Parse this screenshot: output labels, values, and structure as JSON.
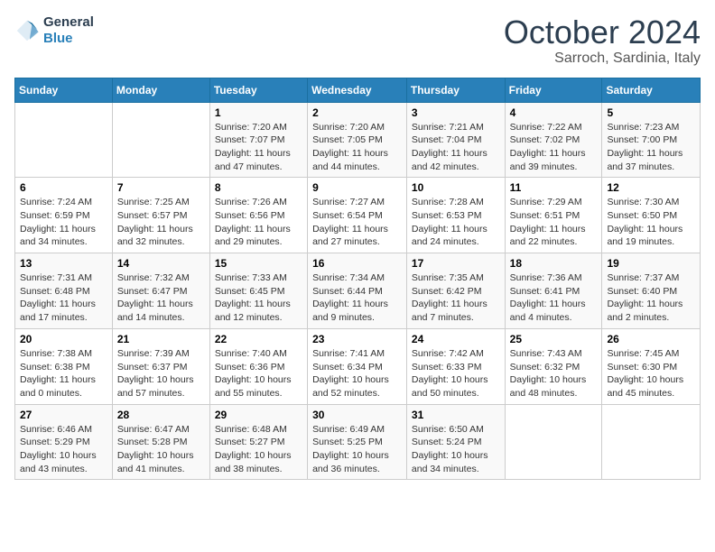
{
  "logo": {
    "line1": "General",
    "line2": "Blue"
  },
  "title": "October 2024",
  "location": "Sarroch, Sardinia, Italy",
  "headers": [
    "Sunday",
    "Monday",
    "Tuesday",
    "Wednesday",
    "Thursday",
    "Friday",
    "Saturday"
  ],
  "weeks": [
    [
      {
        "day": "",
        "info": ""
      },
      {
        "day": "",
        "info": ""
      },
      {
        "day": "1",
        "info": "Sunrise: 7:20 AM\nSunset: 7:07 PM\nDaylight: 11 hours and 47 minutes."
      },
      {
        "day": "2",
        "info": "Sunrise: 7:20 AM\nSunset: 7:05 PM\nDaylight: 11 hours and 44 minutes."
      },
      {
        "day": "3",
        "info": "Sunrise: 7:21 AM\nSunset: 7:04 PM\nDaylight: 11 hours and 42 minutes."
      },
      {
        "day": "4",
        "info": "Sunrise: 7:22 AM\nSunset: 7:02 PM\nDaylight: 11 hours and 39 minutes."
      },
      {
        "day": "5",
        "info": "Sunrise: 7:23 AM\nSunset: 7:00 PM\nDaylight: 11 hours and 37 minutes."
      }
    ],
    [
      {
        "day": "6",
        "info": "Sunrise: 7:24 AM\nSunset: 6:59 PM\nDaylight: 11 hours and 34 minutes."
      },
      {
        "day": "7",
        "info": "Sunrise: 7:25 AM\nSunset: 6:57 PM\nDaylight: 11 hours and 32 minutes."
      },
      {
        "day": "8",
        "info": "Sunrise: 7:26 AM\nSunset: 6:56 PM\nDaylight: 11 hours and 29 minutes."
      },
      {
        "day": "9",
        "info": "Sunrise: 7:27 AM\nSunset: 6:54 PM\nDaylight: 11 hours and 27 minutes."
      },
      {
        "day": "10",
        "info": "Sunrise: 7:28 AM\nSunset: 6:53 PM\nDaylight: 11 hours and 24 minutes."
      },
      {
        "day": "11",
        "info": "Sunrise: 7:29 AM\nSunset: 6:51 PM\nDaylight: 11 hours and 22 minutes."
      },
      {
        "day": "12",
        "info": "Sunrise: 7:30 AM\nSunset: 6:50 PM\nDaylight: 11 hours and 19 minutes."
      }
    ],
    [
      {
        "day": "13",
        "info": "Sunrise: 7:31 AM\nSunset: 6:48 PM\nDaylight: 11 hours and 17 minutes."
      },
      {
        "day": "14",
        "info": "Sunrise: 7:32 AM\nSunset: 6:47 PM\nDaylight: 11 hours and 14 minutes."
      },
      {
        "day": "15",
        "info": "Sunrise: 7:33 AM\nSunset: 6:45 PM\nDaylight: 11 hours and 12 minutes."
      },
      {
        "day": "16",
        "info": "Sunrise: 7:34 AM\nSunset: 6:44 PM\nDaylight: 11 hours and 9 minutes."
      },
      {
        "day": "17",
        "info": "Sunrise: 7:35 AM\nSunset: 6:42 PM\nDaylight: 11 hours and 7 minutes."
      },
      {
        "day": "18",
        "info": "Sunrise: 7:36 AM\nSunset: 6:41 PM\nDaylight: 11 hours and 4 minutes."
      },
      {
        "day": "19",
        "info": "Sunrise: 7:37 AM\nSunset: 6:40 PM\nDaylight: 11 hours and 2 minutes."
      }
    ],
    [
      {
        "day": "20",
        "info": "Sunrise: 7:38 AM\nSunset: 6:38 PM\nDaylight: 11 hours and 0 minutes."
      },
      {
        "day": "21",
        "info": "Sunrise: 7:39 AM\nSunset: 6:37 PM\nDaylight: 10 hours and 57 minutes."
      },
      {
        "day": "22",
        "info": "Sunrise: 7:40 AM\nSunset: 6:36 PM\nDaylight: 10 hours and 55 minutes."
      },
      {
        "day": "23",
        "info": "Sunrise: 7:41 AM\nSunset: 6:34 PM\nDaylight: 10 hours and 52 minutes."
      },
      {
        "day": "24",
        "info": "Sunrise: 7:42 AM\nSunset: 6:33 PM\nDaylight: 10 hours and 50 minutes."
      },
      {
        "day": "25",
        "info": "Sunrise: 7:43 AM\nSunset: 6:32 PM\nDaylight: 10 hours and 48 minutes."
      },
      {
        "day": "26",
        "info": "Sunrise: 7:45 AM\nSunset: 6:30 PM\nDaylight: 10 hours and 45 minutes."
      }
    ],
    [
      {
        "day": "27",
        "info": "Sunrise: 6:46 AM\nSunset: 5:29 PM\nDaylight: 10 hours and 43 minutes."
      },
      {
        "day": "28",
        "info": "Sunrise: 6:47 AM\nSunset: 5:28 PM\nDaylight: 10 hours and 41 minutes."
      },
      {
        "day": "29",
        "info": "Sunrise: 6:48 AM\nSunset: 5:27 PM\nDaylight: 10 hours and 38 minutes."
      },
      {
        "day": "30",
        "info": "Sunrise: 6:49 AM\nSunset: 5:25 PM\nDaylight: 10 hours and 36 minutes."
      },
      {
        "day": "31",
        "info": "Sunrise: 6:50 AM\nSunset: 5:24 PM\nDaylight: 10 hours and 34 minutes."
      },
      {
        "day": "",
        "info": ""
      },
      {
        "day": "",
        "info": ""
      }
    ]
  ]
}
